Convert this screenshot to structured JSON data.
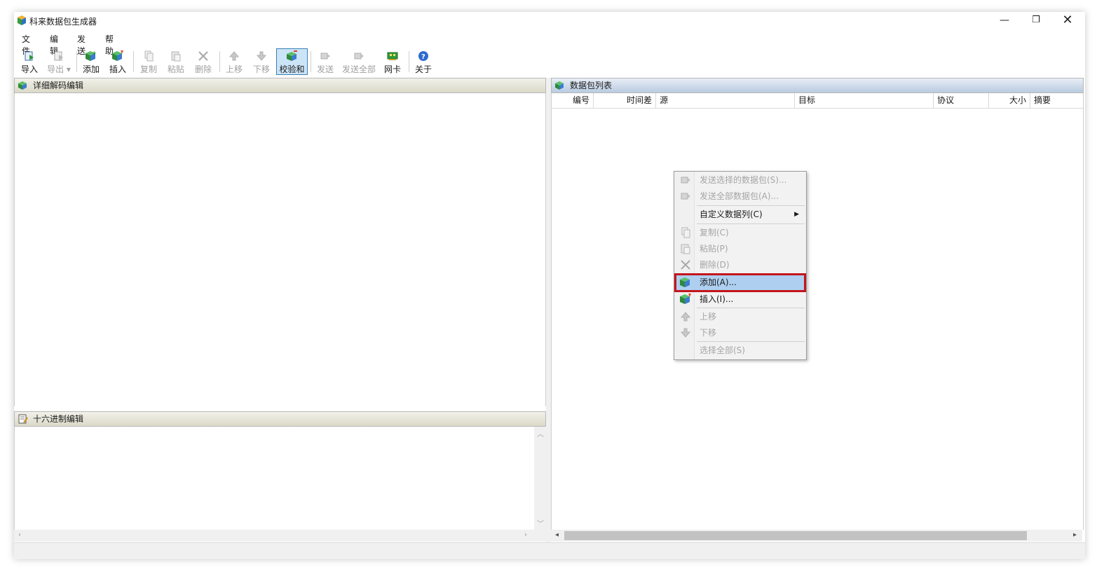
{
  "window": {
    "title": "科来数据包生成器",
    "controls": {
      "minimize": "—",
      "maximize": "❐",
      "close": "✕"
    }
  },
  "menu": [
    "文件",
    "编辑",
    "发送",
    "帮助"
  ],
  "toolbar": {
    "import": "导入",
    "export": "导出",
    "add": "添加",
    "insert": "插入",
    "copy": "复制",
    "paste": "粘贴",
    "delete": "删除",
    "move_up": "上移",
    "move_down": "下移",
    "checksum": "校验和",
    "send": "发送",
    "send_all": "发送全部",
    "nic": "网卡",
    "about": "关于"
  },
  "panels": {
    "decode": {
      "title": "详细解码编辑"
    },
    "hex": {
      "title": "十六进制编辑"
    },
    "packet_list": {
      "title": "数据包列表",
      "columns": [
        "编号",
        "时间差",
        "源",
        "目标",
        "协议",
        "大小",
        "摘要"
      ]
    }
  },
  "context_menu": {
    "send_selected": "发送选择的数据包(S)...",
    "send_all": "发送全部数据包(A)...",
    "custom_columns": "自定义数据列(C)",
    "copy": "复制(C)",
    "paste": "粘贴(P)",
    "delete": "删除(D)",
    "add": "添加(A)...",
    "insert": "插入(I)...",
    "move_up": "上移",
    "move_down": "下移",
    "select_all": "选择全部(S)"
  },
  "colors": {
    "highlight_border": "#c4151c",
    "highlight_fill": "#aecff0",
    "active_button": "#cce4f7"
  }
}
